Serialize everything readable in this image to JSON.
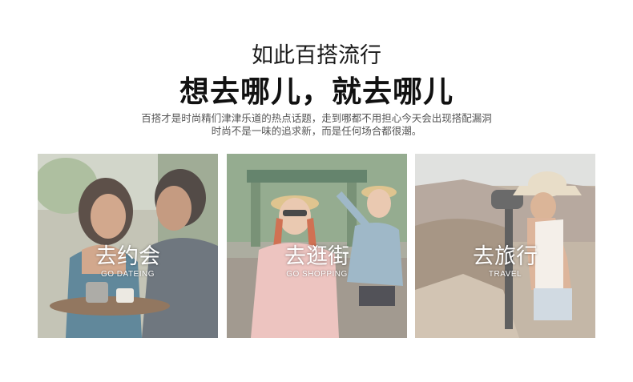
{
  "header": {
    "title": "如此百搭流行",
    "headline": "想去哪儿，就去哪儿",
    "desc_line1": "百搭才是时尚精们津津乐道的热点话题，走到哪都不用担心今天会出现搭配漏洞",
    "desc_line2": "时尚不是一味的追求新，而是任何场合都很潮。"
  },
  "cards": [
    {
      "label": "去约会",
      "sub": "GO DATEING"
    },
    {
      "label": "去逛街",
      "sub": "GO SHOPPING"
    },
    {
      "label": "去旅行",
      "sub": "TRAVEL"
    }
  ]
}
